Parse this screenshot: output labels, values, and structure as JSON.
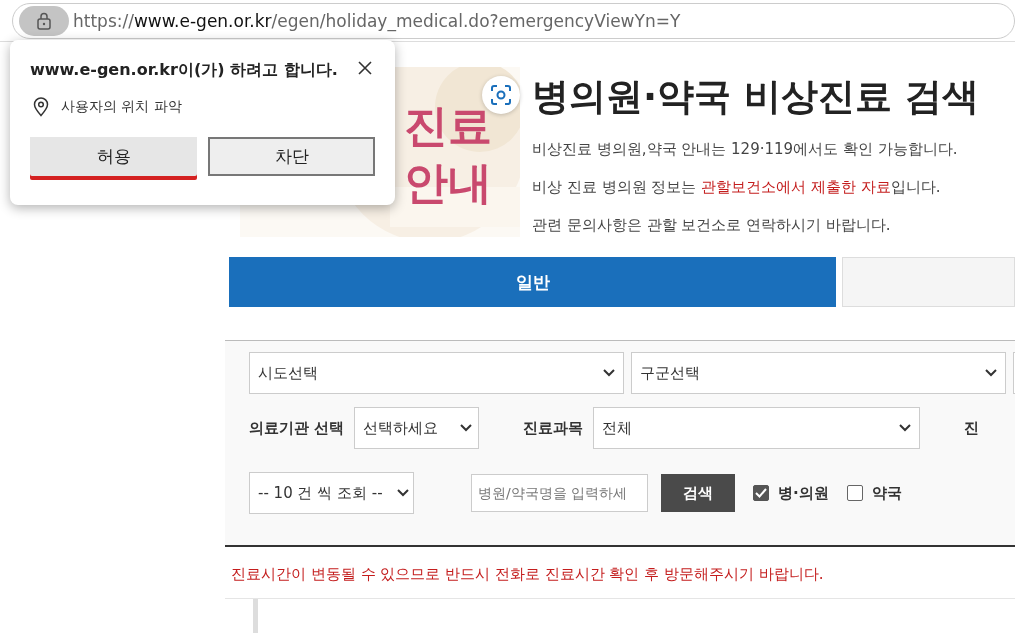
{
  "address_bar": {
    "url_scheme": "https://",
    "url_host": "www.e-gen.or.kr",
    "url_path": "/egen/holiday_medical.do?emergencyViewYn=Y"
  },
  "permission_popup": {
    "title": "www.e-gen.or.kr이(가) 하려고 합니다.",
    "permission": "사용자의 위치 파악",
    "buttons": [
      {
        "label": "허용",
        "selected": true
      },
      {
        "label": "차단",
        "selected": false
      }
    ]
  },
  "banner": {
    "lines": [
      "진료",
      "안내"
    ]
  },
  "header": {
    "title": "병의원·약국 비상진료 검색",
    "notes": [
      {
        "parts": [
          {
            "text": "비상진료 병의원,약국 안내는 129·119에서도 확인 가능합니다.",
            "highlight": false
          }
        ]
      },
      {
        "parts": [
          {
            "text": "비상 진료 병의원 정보는 ",
            "highlight": false
          },
          {
            "text": "관할보건소에서 제출한 자료",
            "highlight": true
          },
          {
            "text": "입니다.",
            "highlight": false
          }
        ]
      },
      {
        "parts": [
          {
            "text": "관련 문의사항은 관할 보건소로 연락하시기 바랍니다.",
            "highlight": false
          }
        ]
      }
    ]
  },
  "tabs": [
    {
      "label": "일반",
      "selected": true
    },
    {
      "selected": false
    }
  ],
  "search": {
    "region_select": "시도선택",
    "district_select": "구군선택",
    "institution_label": "의료기관 선택",
    "institution_select": "선택하세요",
    "subject_label": "진료과목",
    "subject_select": "전체",
    "cut_label": "진",
    "page_size_select": "-- 10 건 씩 조회 --",
    "name_field": {
      "placeholder": "병원/약국명을 입력하세"
    },
    "search_button": "검색",
    "filters": [
      {
        "label": "병·의원",
        "checked": true
      },
      {
        "label": "약국",
        "checked": false
      }
    ]
  },
  "notice": "진료시간이 변동될 수 있으므로 반드시 전화로 진료시간 확인 후 방문해주시기 바랍니다."
}
